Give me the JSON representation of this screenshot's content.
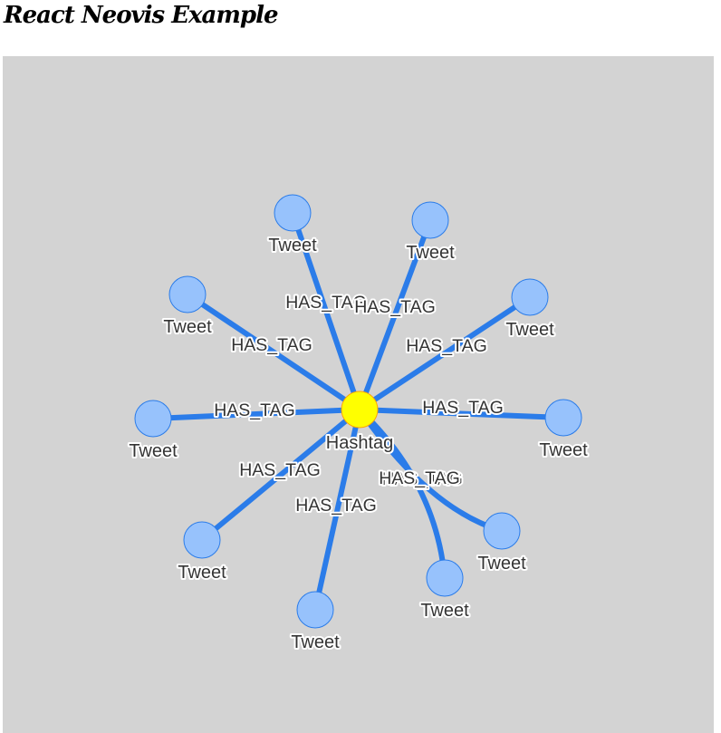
{
  "page": {
    "title": "React Neovis Example"
  },
  "graph": {
    "center": {
      "label": "Hashtag",
      "color": "#ffff00"
    },
    "tweet_label": "Tweet",
    "edge_label": "HAS_TAG",
    "tweet_color": "#97c2fc",
    "edge_color": "#2b7ce9",
    "background": "#d3d3d3",
    "tweet_count": 10,
    "edge_count": 10
  }
}
